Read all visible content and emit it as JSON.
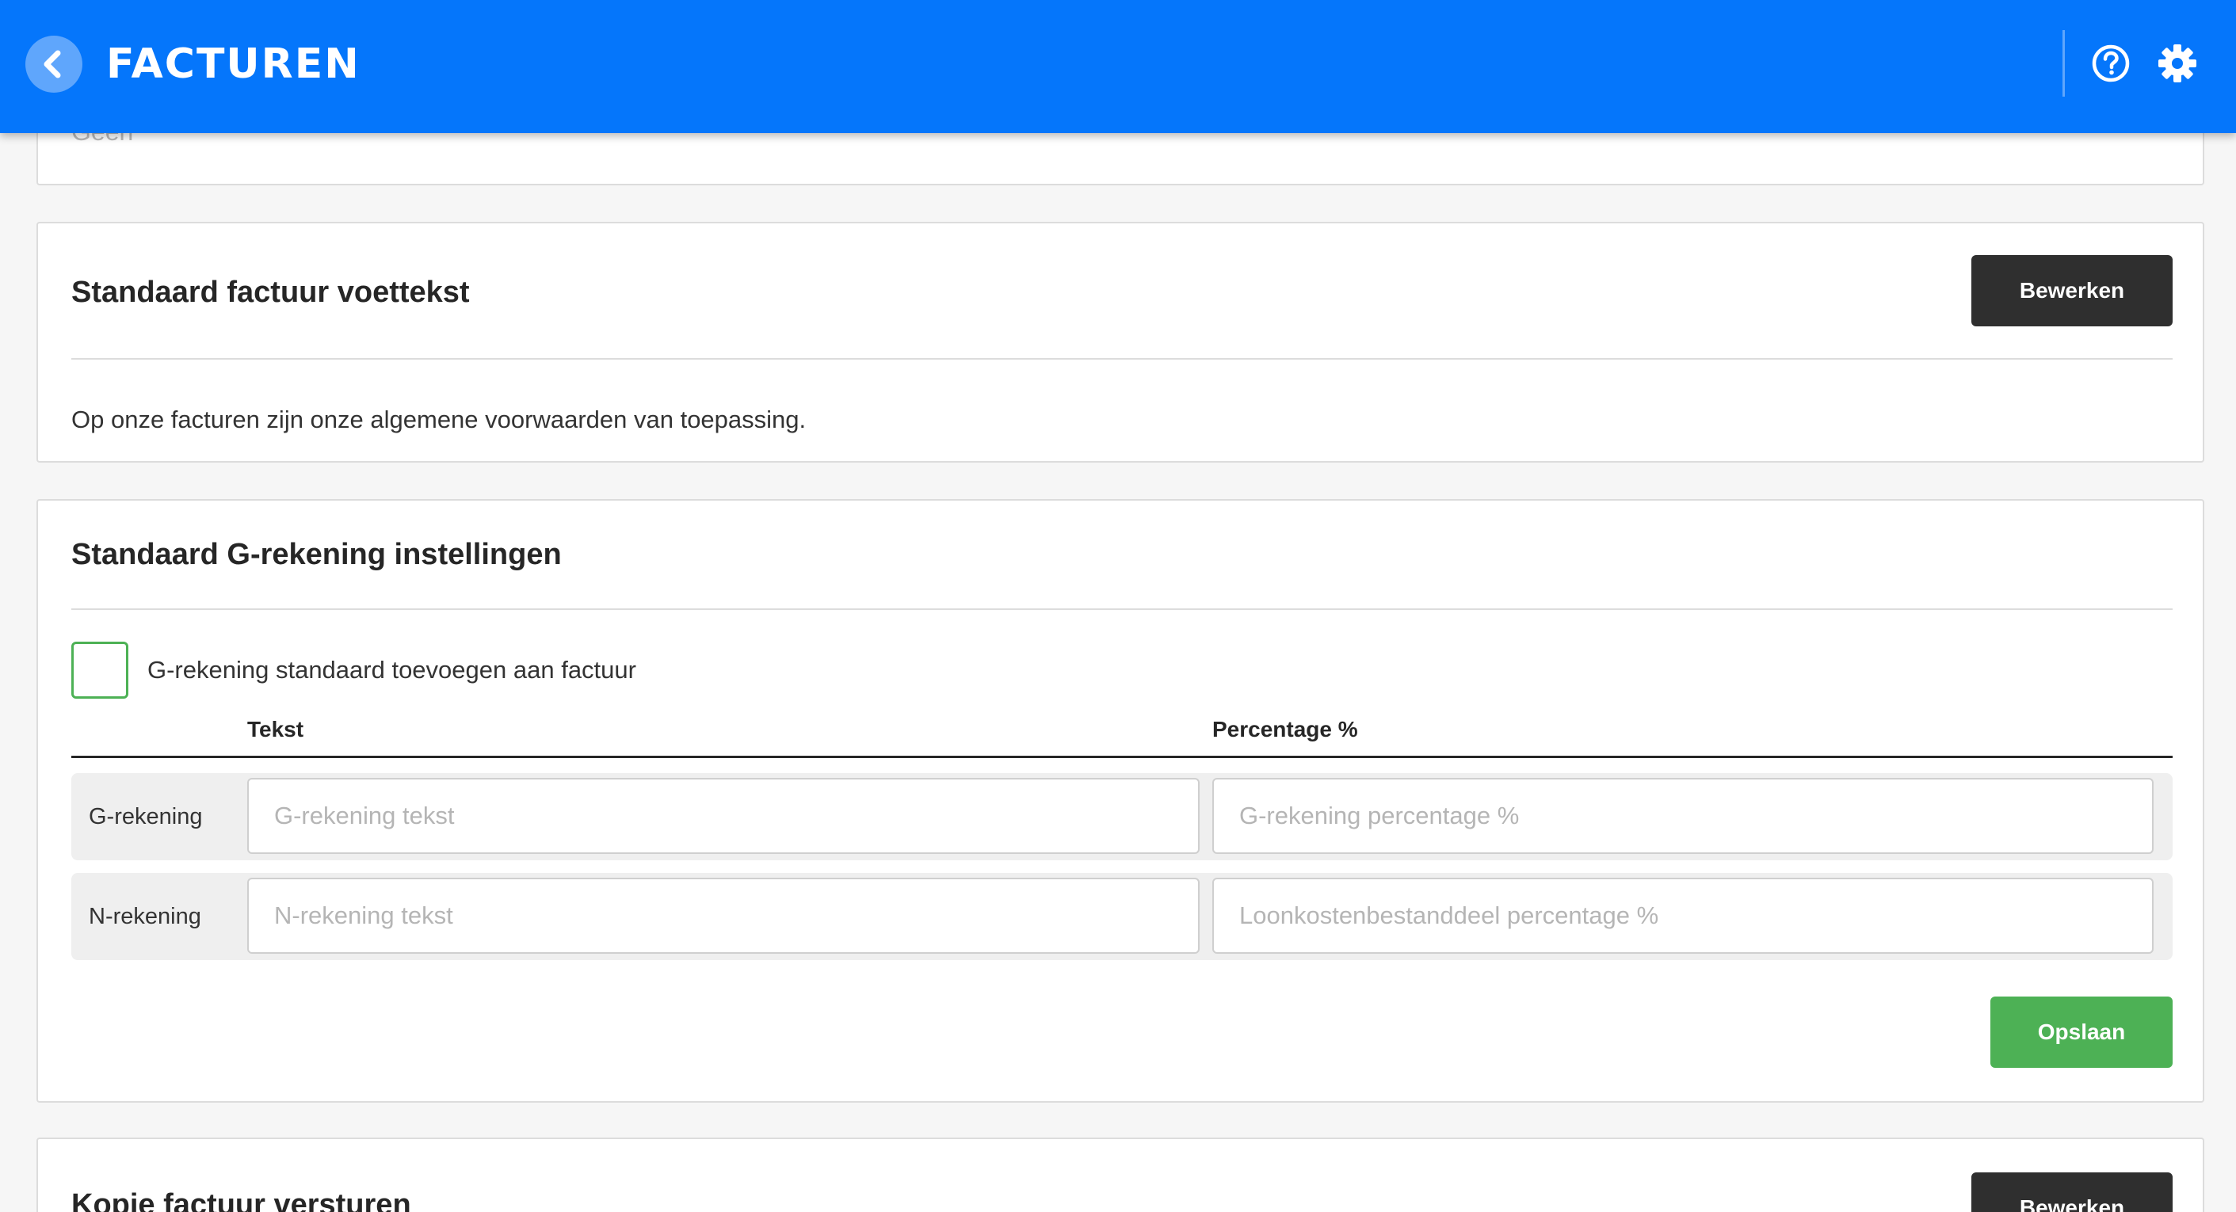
{
  "header": {
    "title": "FACTUREN",
    "back_icon": "chevron-left-icon",
    "help_icon": "help-circle-icon",
    "settings_icon": "gear-icon",
    "bar_color": "#0576fb"
  },
  "previous_card": {
    "value": "Geen"
  },
  "footer_card": {
    "title": "Standaard factuur voettekst",
    "edit_label": "Bewerken",
    "text": "Op onze facturen zijn onze algemene voorwaarden van toepassing."
  },
  "g_account_card": {
    "title": "Standaard G-rekening instellingen",
    "checkbox_label": "G-rekening standaard toevoegen aan factuur",
    "checkbox_checked": false,
    "columns": [
      "Tekst",
      "Percentage %"
    ],
    "rows": [
      {
        "label": "G-rekening",
        "text_value": "",
        "text_placeholder": "G-rekening tekst",
        "percentage_value": "",
        "percentage_placeholder": "G-rekening percentage %"
      },
      {
        "label": "N-rekening",
        "text_value": "",
        "text_placeholder": "N-rekening tekst",
        "percentage_value": "",
        "percentage_placeholder": "Loonkostenbestanddeel percentage %"
      }
    ],
    "save_label": "Opslaan",
    "accent_color": "#4db155"
  },
  "copy_card": {
    "title": "Kopie factuur versturen",
    "edit_label": "Bewerken"
  }
}
